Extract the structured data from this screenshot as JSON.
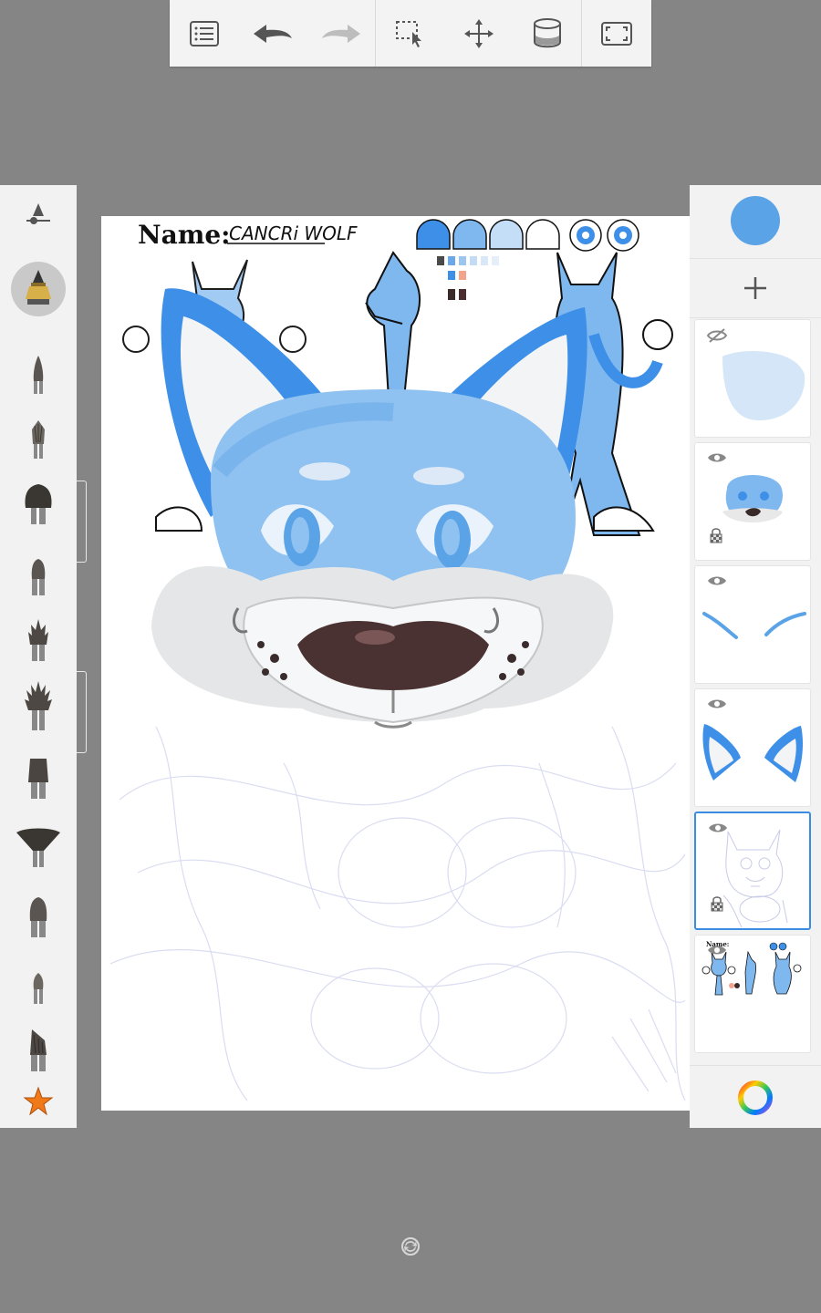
{
  "toolbar": {
    "buttons": [
      {
        "name": "menu-icon"
      },
      {
        "name": "undo-icon"
      },
      {
        "name": "redo-icon"
      },
      {
        "name": "selection-icon"
      },
      {
        "name": "transform-icon"
      },
      {
        "name": "fill-bucket-icon"
      },
      {
        "name": "fullscreen-icon"
      }
    ]
  },
  "brushes": [
    {
      "name": "brush-size-slider-icon"
    },
    {
      "name": "airbrush-icon",
      "selected": true
    },
    {
      "name": "pencil-brush-icon"
    },
    {
      "name": "ink-pen-brush-icon"
    },
    {
      "name": "round-brush-icon"
    },
    {
      "name": "flat-brush-icon"
    },
    {
      "name": "spiky-brush-icon"
    },
    {
      "name": "fan-spiky-brush-icon"
    },
    {
      "name": "flat-wide-brush-icon"
    },
    {
      "name": "fan-brush-icon"
    },
    {
      "name": "filbert-brush-icon"
    },
    {
      "name": "small-round-brush-icon"
    },
    {
      "name": "angled-brush-icon"
    },
    {
      "name": "favorites-star-icon"
    }
  ],
  "colors": {
    "current": "#5aa3e6",
    "accent": "#3a8de0",
    "star": "#f07a1a"
  },
  "canvas": {
    "sheet_name_label": "Name:",
    "sheet_name_value": "CANCRi WOLF"
  },
  "layers": [
    {
      "visible": false,
      "locked": false,
      "content": "light-blue-fur-base"
    },
    {
      "visible": true,
      "locked": true,
      "content": "face-render"
    },
    {
      "visible": true,
      "locked": false,
      "content": "eyebrow-strokes"
    },
    {
      "visible": true,
      "locked": false,
      "content": "ears"
    },
    {
      "visible": true,
      "locked": true,
      "content": "sketch",
      "selected": true
    },
    {
      "visible": true,
      "locked": false,
      "content": "reference-sheet",
      "sheet_name_label": "Name:"
    }
  ]
}
